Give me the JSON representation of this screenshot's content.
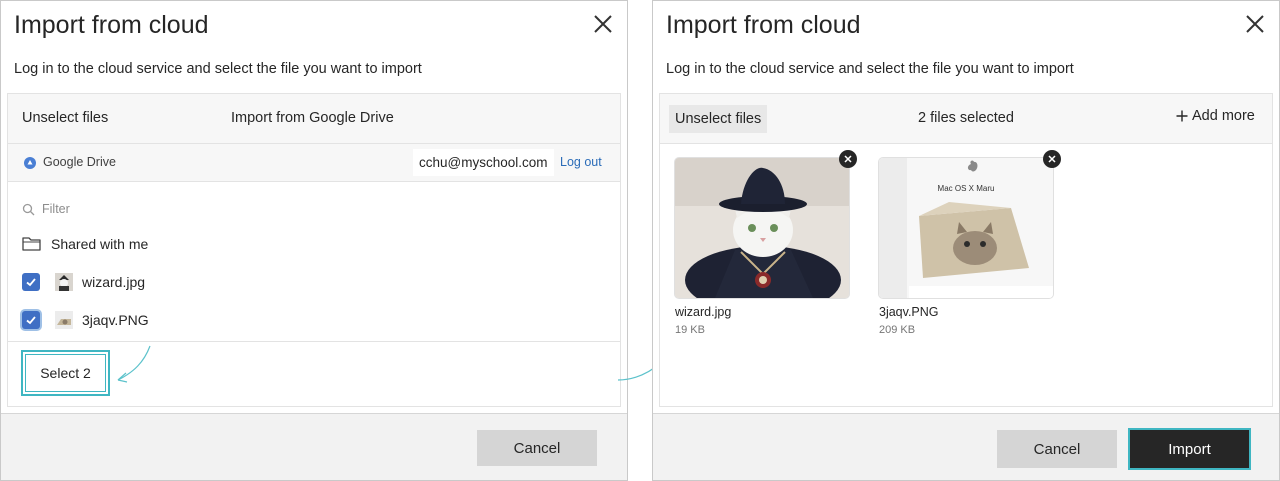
{
  "left_dialog": {
    "title": "Import from cloud",
    "instructions": "Log in to the cloud service and select the file you want to import",
    "header": {
      "unselect_label": "Unselect files",
      "heading": "Import from Google Drive"
    },
    "account": {
      "service": "Google Drive",
      "email": "cchu@myschool.com",
      "logout_label": "Log out"
    },
    "filter_placeholder": "Filter",
    "shared_folder": "Shared with me",
    "files": [
      {
        "name": "wizard.jpg",
        "checked": true
      },
      {
        "name": "3jaqv.PNG",
        "checked": true
      }
    ],
    "select_button": "Select 2",
    "cancel_button": "Cancel"
  },
  "right_dialog": {
    "title": "Import from cloud",
    "instructions": "Log in to the cloud service and select the file you want to import",
    "header": {
      "unselect_label": "Unselect files",
      "selected_count": "2 files selected",
      "add_more_label": "Add more"
    },
    "files": [
      {
        "name": "wizard.jpg",
        "size": "19 KB"
      },
      {
        "name": "3jaqv.PNG",
        "size": "209 KB"
      }
    ],
    "thumbnail_text": {
      "box_title": "Mac OS X Maru"
    },
    "cancel_button": "Cancel",
    "import_button": "Import"
  },
  "colors": {
    "highlight_teal": "#3fb6c2",
    "checkbox_blue": "#3f6fc4",
    "logout_blue": "#2b6cb8",
    "import_button_bg": "#262626"
  }
}
